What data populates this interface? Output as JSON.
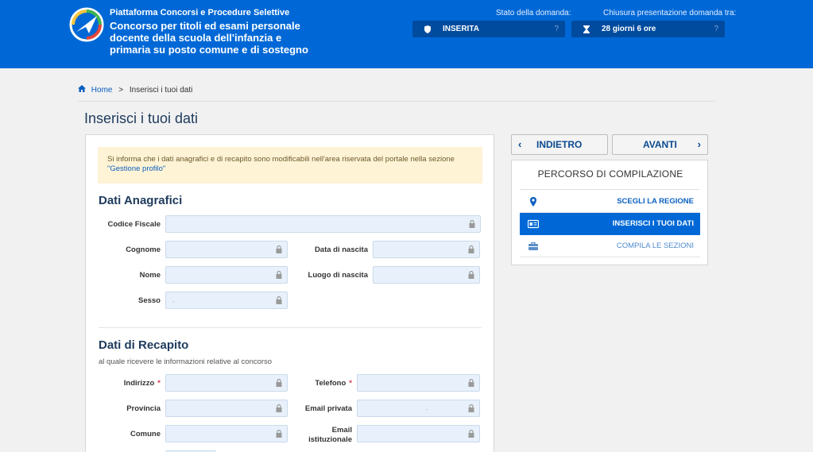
{
  "header": {
    "platform": "Piattaforma Concorsi e Procedure Selettive",
    "title": "Concorso per titoli ed esami personale docente della scuola dell'infanzia e primaria su posto comune e di sostegno",
    "status_label": "Stato della domanda:",
    "status_value": "INSERITA",
    "deadline_label": "Chiusura presentazione domanda tra:",
    "deadline_value": "28 giorni 6 ore",
    "help": "?"
  },
  "breadcrumb": {
    "home": "Home",
    "separator": ">",
    "current": "Inserisci i tuoi dati"
  },
  "page_title": "Inserisci i tuoi dati",
  "notice": {
    "text": "Si informa che i dati anagrafici e di recapito sono modificabili nell'area riservata del portale nella sezione",
    "link": "\"Gestione profilo\""
  },
  "anagrafici": {
    "title": "Dati Anagrafici",
    "codice_fiscale": "Codice Fiscale",
    "cognome": "Cognome",
    "data_nascita": "Data di nascita",
    "nome": "Nome",
    "luogo_nascita": "Luogo di nascita",
    "sesso": "Sesso",
    "sesso_value": "."
  },
  "recapito": {
    "title": "Dati di Recapito",
    "subtitle": "al quale ricevere le informazioni relative al concorso",
    "indirizzo": "Indirizzo",
    "telefono": "Telefono",
    "provincia": "Provincia",
    "email_privata": "Email privata",
    "email_privata_value": ".",
    "comune": "Comune",
    "email_ist_1": "Email",
    "email_ist_2": "istituzionale",
    "required_mark": "*"
  },
  "nav": {
    "back": "INDIETRO",
    "next": "AVANTI",
    "back_chev": "‹",
    "next_chev": "›"
  },
  "steps": {
    "title": "PERCORSO DI COMPILAZIONE",
    "items": [
      {
        "label": "SCEGLI LA REGIONE",
        "icon": "location-pin-icon"
      },
      {
        "label": "INSERISCI I TUOI DATI",
        "icon": "id-card-icon",
        "active": true
      },
      {
        "label": "COMPILA LE SEZIONI",
        "icon": "briefcase-icon"
      }
    ]
  },
  "colors": {
    "header_bg": "#0068d6",
    "accent": "#0b5fc0",
    "required": "#d9364f",
    "notice_bg": "#fff3d6"
  }
}
